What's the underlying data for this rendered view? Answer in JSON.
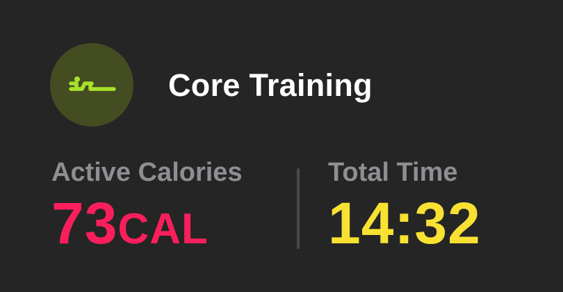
{
  "workout": {
    "name": "Core Training",
    "icon": "core-training-icon",
    "icon_color": "#a6e32a",
    "icon_background": "#444c22"
  },
  "metrics": {
    "calories": {
      "label": "Active Calories",
      "value": "73",
      "unit": "CAL",
      "color": "#fa1f5b"
    },
    "time": {
      "label": "Total Time",
      "value": "14:32",
      "color": "#f8e132"
    }
  }
}
